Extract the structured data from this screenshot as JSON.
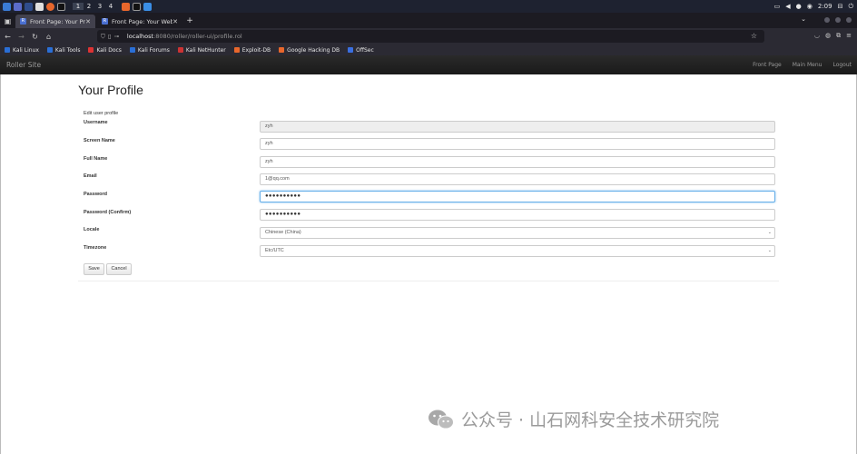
{
  "taskbar": {
    "workspaces": [
      "1",
      "2",
      "3",
      "4"
    ],
    "clock": "2:09"
  },
  "browser": {
    "tabs": [
      {
        "title": "Front Page: Your Profile",
        "active": true
      },
      {
        "title": "Front Page: Your Weblog",
        "active": false
      }
    ],
    "url_host": "localhost",
    "url_path": ":8080/roller/roller-ui/profile.rol",
    "bookmarks": [
      "Kali Linux",
      "Kali Tools",
      "Kali Docs",
      "Kali Forums",
      "Kali NetHunter",
      "Exploit-DB",
      "Google Hacking DB",
      "OffSec"
    ]
  },
  "site": {
    "brand": "Roller Site",
    "links": [
      "Front Page",
      "Main Menu",
      "Logout"
    ]
  },
  "page": {
    "title": "Your Profile",
    "caption": "Edit user profile",
    "fields": [
      {
        "label": "Username",
        "value": "zyh"
      },
      {
        "label": "Screen Name",
        "value": "zyh"
      },
      {
        "label": "Full Name",
        "value": "zyh"
      },
      {
        "label": "Email",
        "value": "1@qq.com"
      },
      {
        "label": "Password",
        "value": "●●●●●●●●●●"
      },
      {
        "label": "Password (Confirm)",
        "value": "●●●●●●●●●●"
      },
      {
        "label": "Locale",
        "value": "Chinese (China)"
      },
      {
        "label": "Timezone",
        "value": "Etc/UTC"
      }
    ],
    "save_label": "Save",
    "cancel_label": "Cancel"
  },
  "watermark": {
    "text": "公众号 · 山石网科安全技术研究院"
  },
  "colors": {
    "focus": "#66afe9",
    "site_nav_bg": "#1f1f1f",
    "browser_bg": "#2b2a33"
  }
}
